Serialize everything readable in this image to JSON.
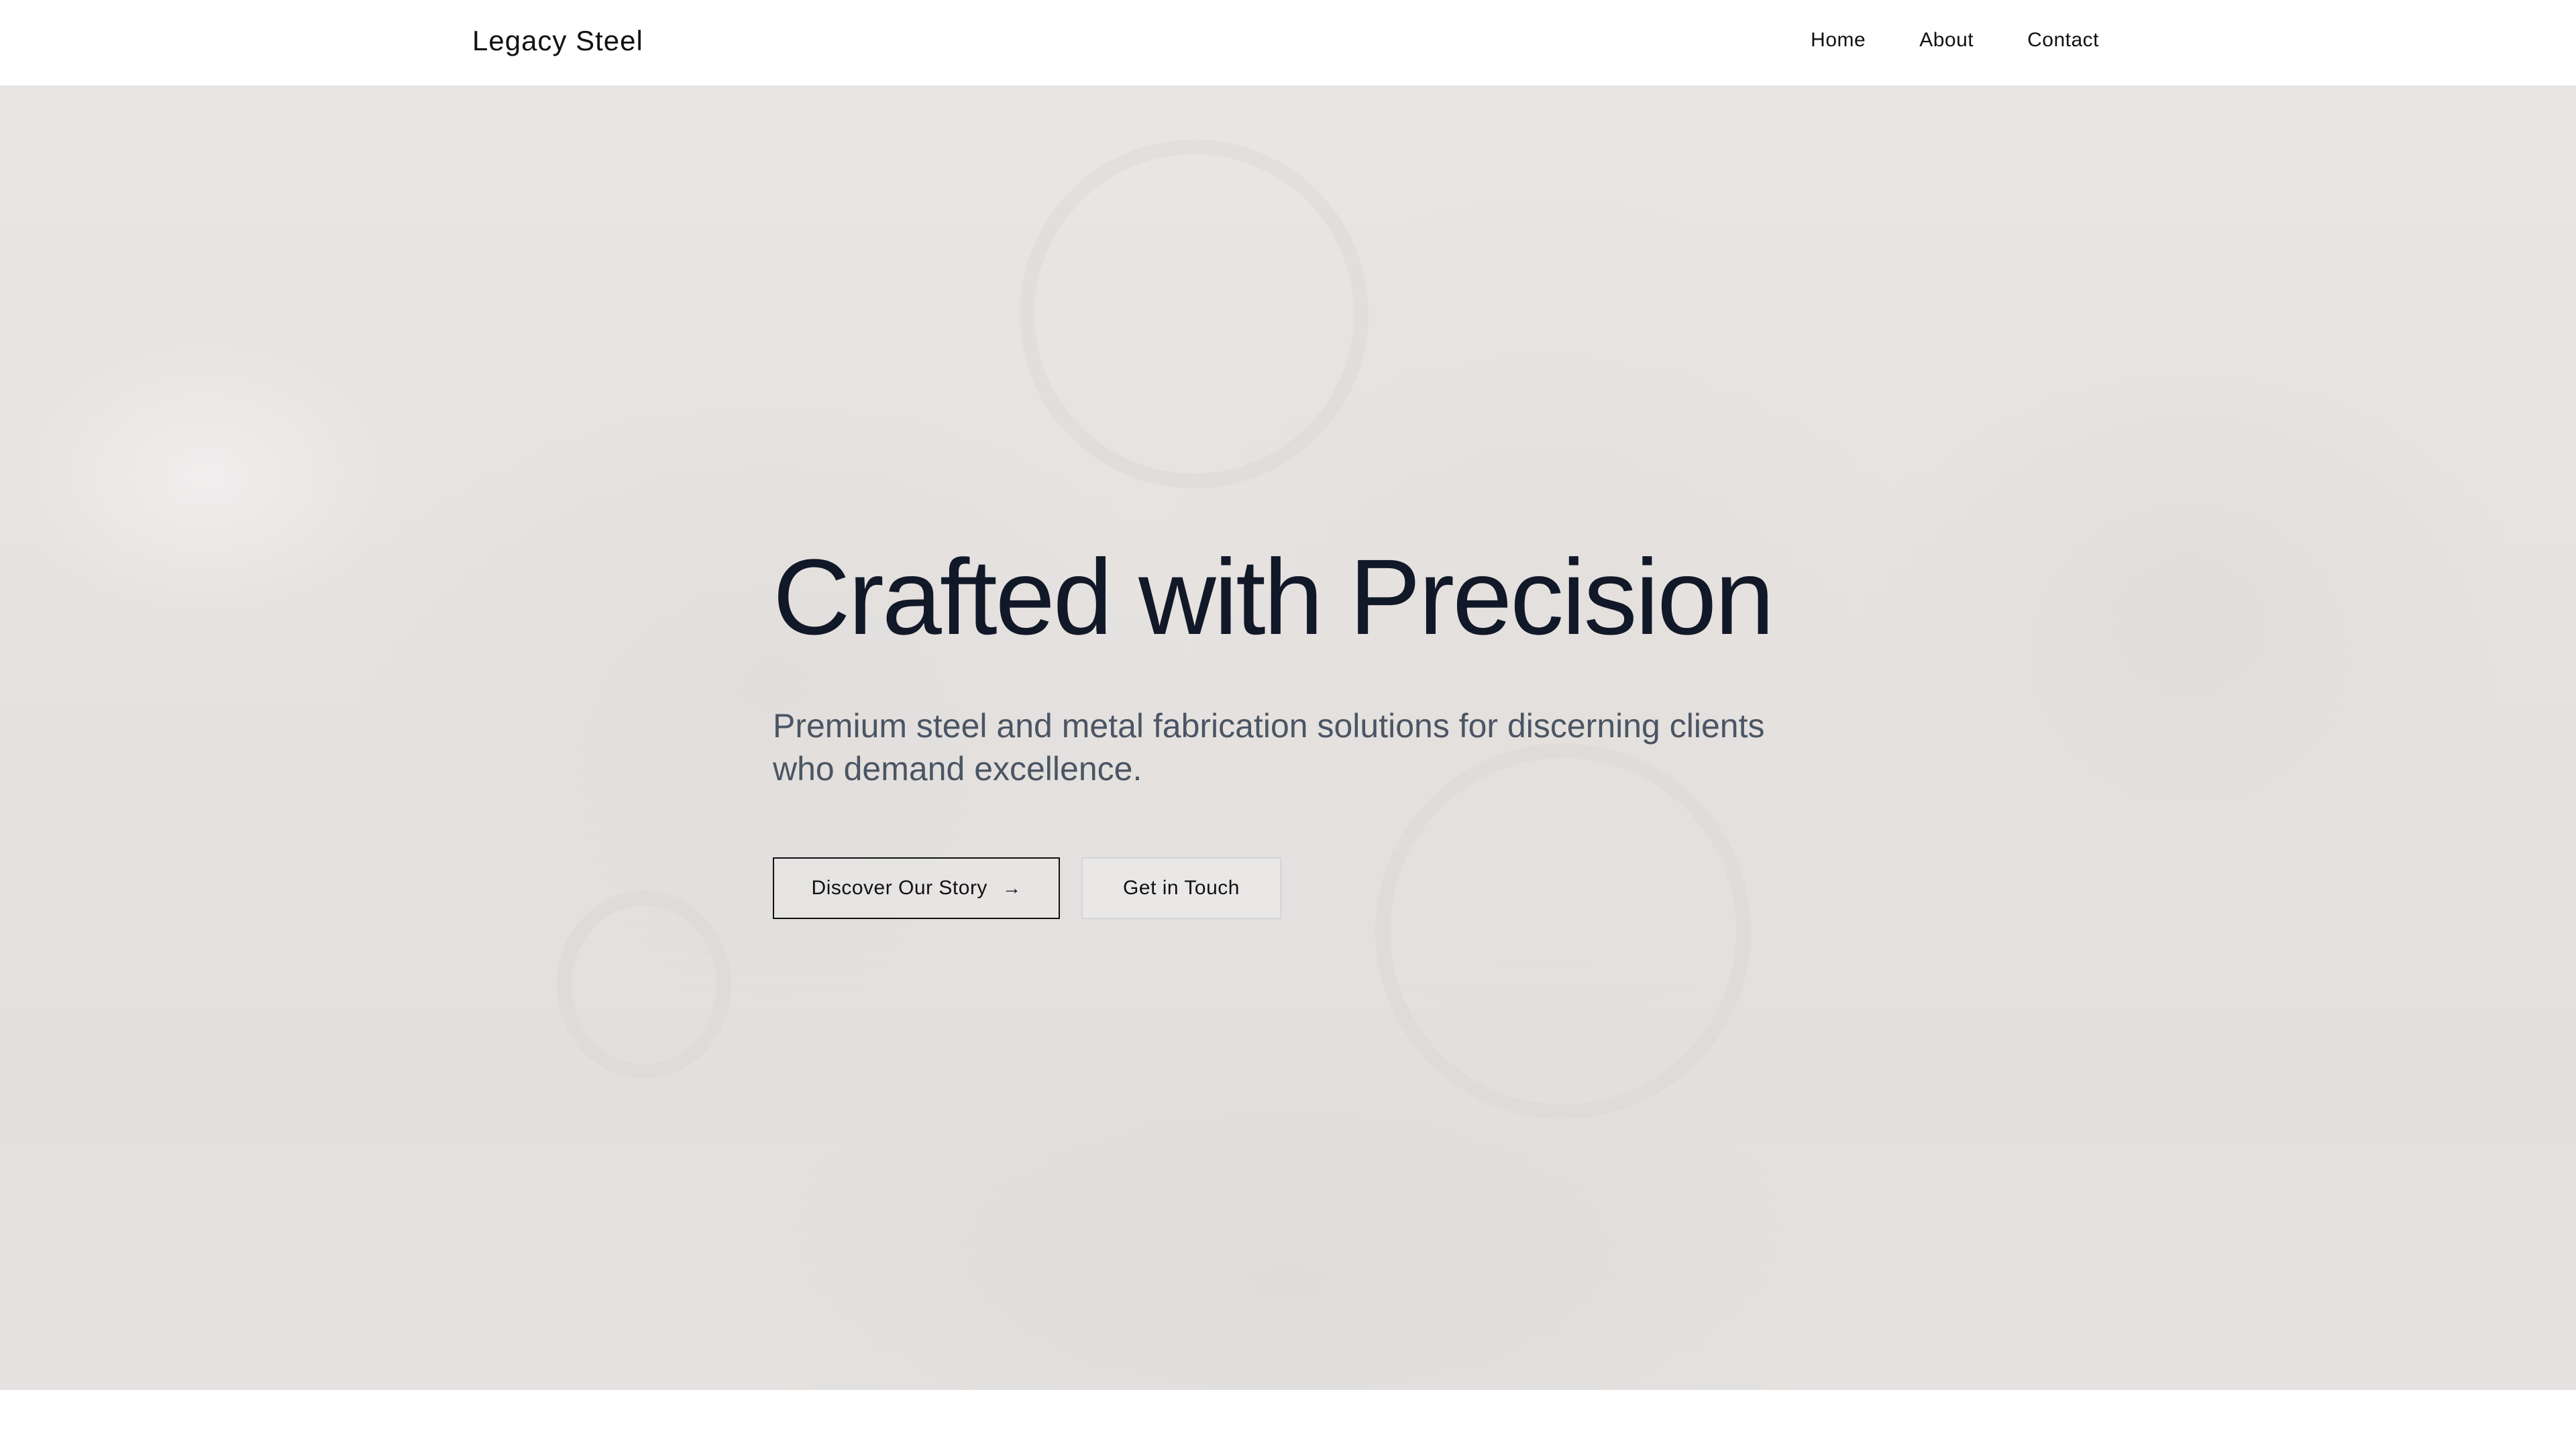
{
  "header": {
    "brand": "Legacy Steel",
    "nav": [
      "Home",
      "About",
      "Contact"
    ]
  },
  "hero": {
    "title": "Crafted with Precision",
    "subtitle": "Premium steel and metal fabrication solutions for discerning clients who demand excellence.",
    "primary_button": "Discover Our Story",
    "primary_icon": "arrow-right-icon",
    "arrow_glyph": "→",
    "secondary_button": "Get in Touch"
  },
  "colors": {
    "text": "#111827",
    "subtitle": "#4b5563",
    "background": "#ffffff"
  }
}
